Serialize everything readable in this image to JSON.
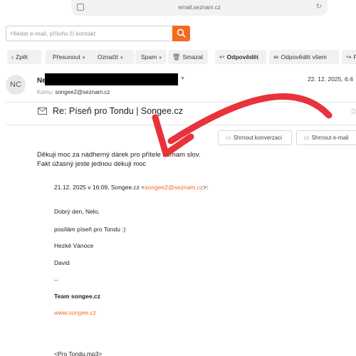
{
  "browser": {
    "url": "email.seznam.cz"
  },
  "search": {
    "placeholder": "Hledat e-mail, přílohu či kontakt"
  },
  "toolbar": {
    "back": "Zpět",
    "move": "Přesunout",
    "mark": "Označit",
    "spam": "Spam",
    "delete": "Smazat",
    "reply": "Odpovědět",
    "reply_all": "Odpovědět všem",
    "forward": "Př"
  },
  "message": {
    "avatar_initials": "NC",
    "sender_visible": "Ne",
    "to_label": "Komu:",
    "to": "songee2@seznam.cz",
    "date": "22. 12. 2025, 6:4",
    "subject": "Re: Píseň pro Tondu | Songee.cz",
    "summarize_conversation": "Shrnout konverzaci",
    "summarize_email": "Shrnout e-mail",
    "body_line1": "Děkuji moc za nádherný dárek pro přítele nemam slov.",
    "body_line2": "Fakt úžasný jeste jednou dekuji moc",
    "quote_header_prefix": "21.12. 2025 v 16:09, Songee.cz <",
    "quote_email": "songee2@seznam.cz",
    "quote_header_suffix": ">:",
    "quote_greeting": "Dobrý den, Nelo,",
    "quote_text": "posílám píseň pro Tondu :)",
    "quote_wish": "Hezké Vánoce",
    "quote_name": "David",
    "quote_sig_sep": "--",
    "quote_team": "Team songee.cz",
    "quote_web": "www.songee.cz",
    "quote_attachment": "<Pro Tondu.mp3>"
  },
  "annotation": {
    "arrow_color": "#e8323c"
  }
}
